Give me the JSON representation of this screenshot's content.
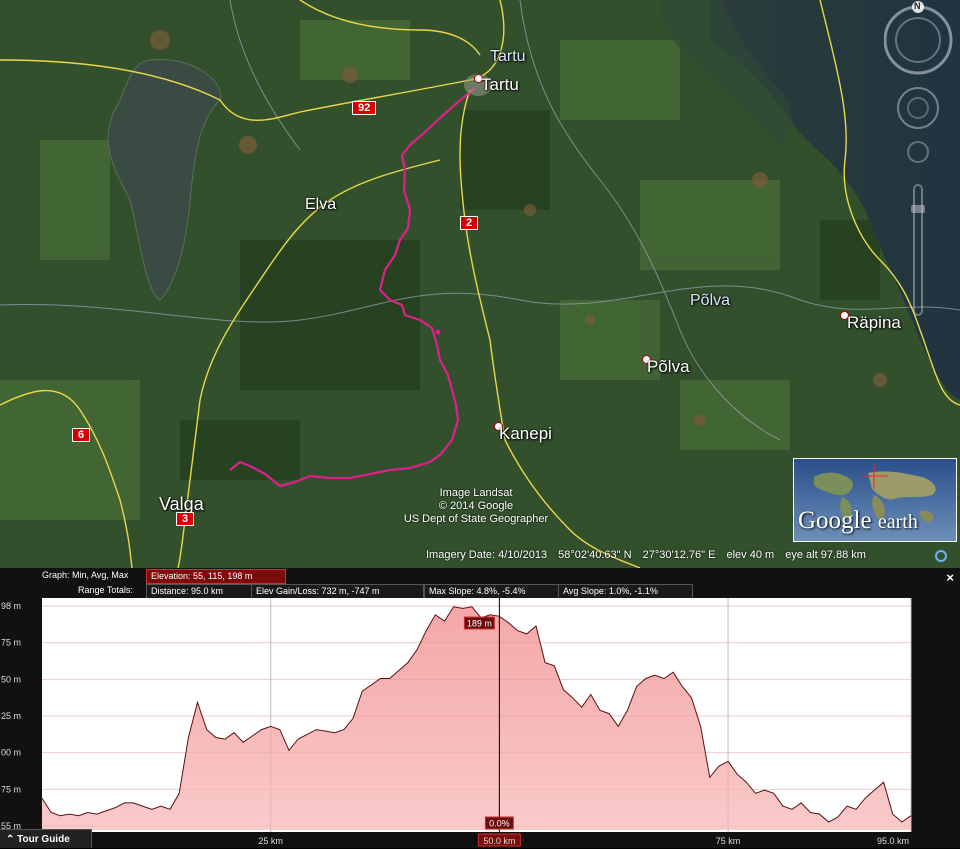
{
  "map": {
    "places": [
      {
        "name": "Tartu",
        "kind": "region"
      },
      {
        "name": "Tartu",
        "kind": "city"
      },
      {
        "name": "Elva",
        "kind": "town"
      },
      {
        "name": "Põlva",
        "kind": "region"
      },
      {
        "name": "Põlva",
        "kind": "town"
      },
      {
        "name": "Räpina",
        "kind": "town"
      },
      {
        "name": "Kanepi",
        "kind": "town"
      },
      {
        "name": "Valga",
        "kind": "town"
      }
    ],
    "road_shields": [
      "92",
      "2",
      "6",
      "3"
    ],
    "attribution": [
      "Image Landsat",
      "© 2014 Google",
      "US Dept of State Geographer"
    ],
    "status": {
      "imagery_date": "Imagery Date: 4/10/2013",
      "lat": "58°02'40.63\" N",
      "lon": "27°30'12.76\" E",
      "elev": "elev   40 m",
      "eye_alt": "eye alt  97.88 km"
    },
    "logo": {
      "google": "Google",
      "earth": "earth"
    },
    "compass_letter": "N",
    "colors": {
      "route": "#e0208a",
      "roads": "#e8d84a",
      "borders": "#9aa8b8",
      "shield": "#d60000"
    }
  },
  "graph": {
    "header": {
      "graph_label": "Graph: Min, Avg, Max",
      "elevation": "Elevation: 55, 115, 198 m",
      "range_label": "Range Totals:",
      "distance": "Distance: 95.0 km",
      "gain_loss": "Elev Gain/Loss: 732 m, -747 m",
      "max_slope": "Max Slope: 4.8%, -5.4%",
      "avg_slope": "Avg Slope: 1.0%, -1.1%"
    },
    "close_label": "×",
    "cursor": {
      "elev_label": "189 m",
      "slope_label": "0.0%",
      "distance_label": "50.0 km",
      "distance_km": 50.0
    },
    "y_ticks": [
      "98 m",
      "75 m",
      "50 m",
      "25 m",
      "00 m",
      "75 m",
      "55 m"
    ],
    "x_ticks": [
      "25 km",
      "50.0 km",
      "75 km",
      "95.0 km"
    ]
  },
  "tour_guide": {
    "label": "Tour Guide",
    "icon": "chevron-up-icon"
  },
  "chart_data": {
    "type": "area",
    "xlabel": "",
    "ylabel": "",
    "xlim": [
      0,
      95
    ],
    "ylim": [
      55,
      198
    ],
    "x": [
      0,
      1,
      2,
      3,
      4,
      5,
      6,
      7,
      8,
      9,
      10,
      11,
      12,
      13,
      14,
      15,
      16,
      17,
      18,
      19,
      20,
      21,
      22,
      23,
      24,
      25,
      26,
      27,
      28,
      29,
      30,
      31,
      32,
      33,
      34,
      35,
      36,
      37,
      38,
      39,
      40,
      41,
      42,
      43,
      44,
      45,
      46,
      47,
      48,
      49,
      50,
      51,
      52,
      53,
      54,
      55,
      56,
      57,
      58,
      59,
      60,
      61,
      62,
      63,
      64,
      65,
      66,
      67,
      68,
      69,
      70,
      71,
      72,
      73,
      74,
      75,
      76,
      77,
      78,
      79,
      80,
      81,
      82,
      83,
      84,
      85,
      86,
      87,
      88,
      89,
      90,
      91,
      92,
      93,
      94,
      95
    ],
    "y": [
      75,
      66,
      64,
      65,
      64,
      66,
      65,
      67,
      69,
      72,
      72,
      70,
      68,
      70,
      68,
      78,
      113,
      135,
      118,
      113,
      112,
      116,
      110,
      114,
      118,
      120,
      118,
      105,
      112,
      115,
      118,
      117,
      116,
      118,
      125,
      142,
      146,
      150,
      150,
      155,
      160,
      168,
      180,
      190,
      186,
      195,
      194,
      195,
      188,
      190,
      189,
      185,
      180,
      178,
      183,
      160,
      158,
      143,
      138,
      132,
      140,
      130,
      128,
      120,
      130,
      145,
      150,
      152,
      150,
      154,
      145,
      138,
      120,
      88,
      95,
      98,
      90,
      85,
      78,
      80,
      78,
      70,
      68,
      72,
      66,
      65,
      60,
      63,
      70,
      68,
      75,
      80,
      85,
      65,
      60,
      64
    ]
  }
}
